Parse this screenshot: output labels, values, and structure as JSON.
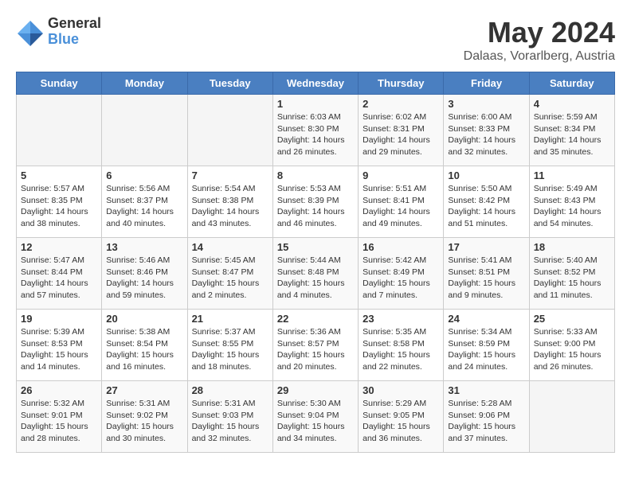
{
  "header": {
    "logo_general": "General",
    "logo_blue": "Blue",
    "title": "May 2024",
    "subtitle": "Dalaas, Vorarlberg, Austria"
  },
  "calendar": {
    "days_of_week": [
      "Sunday",
      "Monday",
      "Tuesday",
      "Wednesday",
      "Thursday",
      "Friday",
      "Saturday"
    ],
    "weeks": [
      [
        {
          "day": "",
          "info": ""
        },
        {
          "day": "",
          "info": ""
        },
        {
          "day": "",
          "info": ""
        },
        {
          "day": "1",
          "info": "Sunrise: 6:03 AM\nSunset: 8:30 PM\nDaylight: 14 hours\nand 26 minutes."
        },
        {
          "day": "2",
          "info": "Sunrise: 6:02 AM\nSunset: 8:31 PM\nDaylight: 14 hours\nand 29 minutes."
        },
        {
          "day": "3",
          "info": "Sunrise: 6:00 AM\nSunset: 8:33 PM\nDaylight: 14 hours\nand 32 minutes."
        },
        {
          "day": "4",
          "info": "Sunrise: 5:59 AM\nSunset: 8:34 PM\nDaylight: 14 hours\nand 35 minutes."
        }
      ],
      [
        {
          "day": "5",
          "info": "Sunrise: 5:57 AM\nSunset: 8:35 PM\nDaylight: 14 hours\nand 38 minutes."
        },
        {
          "day": "6",
          "info": "Sunrise: 5:56 AM\nSunset: 8:37 PM\nDaylight: 14 hours\nand 40 minutes."
        },
        {
          "day": "7",
          "info": "Sunrise: 5:54 AM\nSunset: 8:38 PM\nDaylight: 14 hours\nand 43 minutes."
        },
        {
          "day": "8",
          "info": "Sunrise: 5:53 AM\nSunset: 8:39 PM\nDaylight: 14 hours\nand 46 minutes."
        },
        {
          "day": "9",
          "info": "Sunrise: 5:51 AM\nSunset: 8:41 PM\nDaylight: 14 hours\nand 49 minutes."
        },
        {
          "day": "10",
          "info": "Sunrise: 5:50 AM\nSunset: 8:42 PM\nDaylight: 14 hours\nand 51 minutes."
        },
        {
          "day": "11",
          "info": "Sunrise: 5:49 AM\nSunset: 8:43 PM\nDaylight: 14 hours\nand 54 minutes."
        }
      ],
      [
        {
          "day": "12",
          "info": "Sunrise: 5:47 AM\nSunset: 8:44 PM\nDaylight: 14 hours\nand 57 minutes."
        },
        {
          "day": "13",
          "info": "Sunrise: 5:46 AM\nSunset: 8:46 PM\nDaylight: 14 hours\nand 59 minutes."
        },
        {
          "day": "14",
          "info": "Sunrise: 5:45 AM\nSunset: 8:47 PM\nDaylight: 15 hours\nand 2 minutes."
        },
        {
          "day": "15",
          "info": "Sunrise: 5:44 AM\nSunset: 8:48 PM\nDaylight: 15 hours\nand 4 minutes."
        },
        {
          "day": "16",
          "info": "Sunrise: 5:42 AM\nSunset: 8:49 PM\nDaylight: 15 hours\nand 7 minutes."
        },
        {
          "day": "17",
          "info": "Sunrise: 5:41 AM\nSunset: 8:51 PM\nDaylight: 15 hours\nand 9 minutes."
        },
        {
          "day": "18",
          "info": "Sunrise: 5:40 AM\nSunset: 8:52 PM\nDaylight: 15 hours\nand 11 minutes."
        }
      ],
      [
        {
          "day": "19",
          "info": "Sunrise: 5:39 AM\nSunset: 8:53 PM\nDaylight: 15 hours\nand 14 minutes."
        },
        {
          "day": "20",
          "info": "Sunrise: 5:38 AM\nSunset: 8:54 PM\nDaylight: 15 hours\nand 16 minutes."
        },
        {
          "day": "21",
          "info": "Sunrise: 5:37 AM\nSunset: 8:55 PM\nDaylight: 15 hours\nand 18 minutes."
        },
        {
          "day": "22",
          "info": "Sunrise: 5:36 AM\nSunset: 8:57 PM\nDaylight: 15 hours\nand 20 minutes."
        },
        {
          "day": "23",
          "info": "Sunrise: 5:35 AM\nSunset: 8:58 PM\nDaylight: 15 hours\nand 22 minutes."
        },
        {
          "day": "24",
          "info": "Sunrise: 5:34 AM\nSunset: 8:59 PM\nDaylight: 15 hours\nand 24 minutes."
        },
        {
          "day": "25",
          "info": "Sunrise: 5:33 AM\nSunset: 9:00 PM\nDaylight: 15 hours\nand 26 minutes."
        }
      ],
      [
        {
          "day": "26",
          "info": "Sunrise: 5:32 AM\nSunset: 9:01 PM\nDaylight: 15 hours\nand 28 minutes."
        },
        {
          "day": "27",
          "info": "Sunrise: 5:31 AM\nSunset: 9:02 PM\nDaylight: 15 hours\nand 30 minutes."
        },
        {
          "day": "28",
          "info": "Sunrise: 5:31 AM\nSunset: 9:03 PM\nDaylight: 15 hours\nand 32 minutes."
        },
        {
          "day": "29",
          "info": "Sunrise: 5:30 AM\nSunset: 9:04 PM\nDaylight: 15 hours\nand 34 minutes."
        },
        {
          "day": "30",
          "info": "Sunrise: 5:29 AM\nSunset: 9:05 PM\nDaylight: 15 hours\nand 36 minutes."
        },
        {
          "day": "31",
          "info": "Sunrise: 5:28 AM\nSunset: 9:06 PM\nDaylight: 15 hours\nand 37 minutes."
        },
        {
          "day": "",
          "info": ""
        }
      ]
    ]
  }
}
